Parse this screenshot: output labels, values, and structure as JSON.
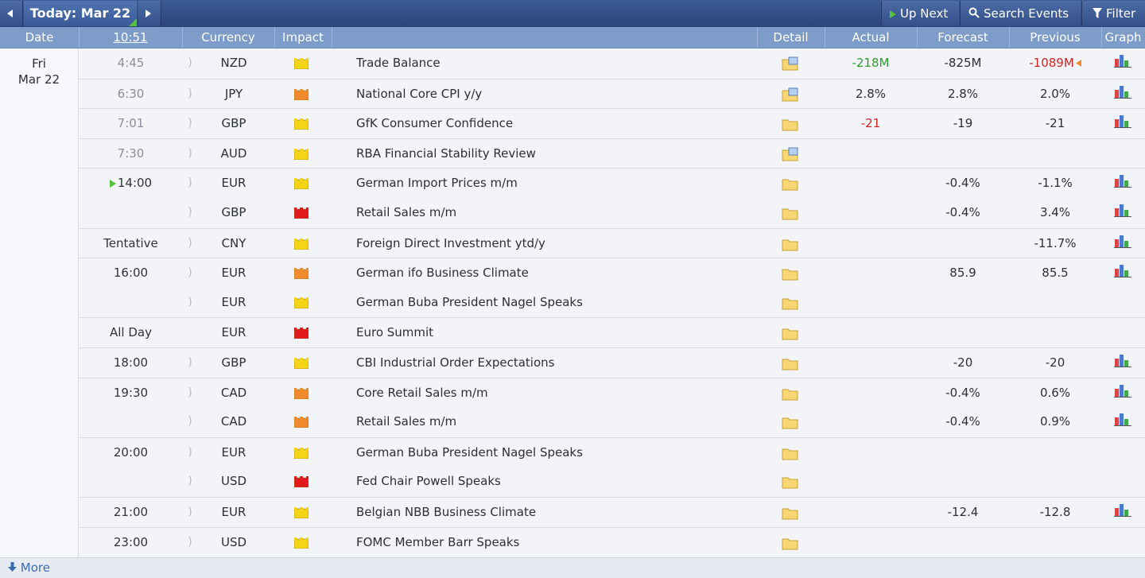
{
  "toolbar": {
    "today_label": "Today: Mar 22",
    "up_next_label": "Up Next",
    "search_label": "Search Events",
    "filter_label": "Filter"
  },
  "header": {
    "date": "Date",
    "time": "10:51",
    "currency": "Currency",
    "impact": "Impact",
    "detail": "Detail",
    "actual": "Actual",
    "forecast": "Forecast",
    "previous": "Previous",
    "graph": "Graph"
  },
  "date_cell": {
    "day": "Fri",
    "date": "Mar 22"
  },
  "colors": {
    "impact_high": "#e01a1a",
    "impact_medium": "#f08a2c",
    "impact_low": "#f5d417",
    "actual_better": "#2d9c2d",
    "actual_worse": "#d32424"
  },
  "events": [
    {
      "time": "4:45",
      "currency": "NZD",
      "impact": "low",
      "title": "Trade Balance",
      "actual": "-218M",
      "actual_color": "green",
      "forecast": "-825M",
      "previous": "-1089M",
      "previous_color": "red",
      "previous_revised": true,
      "graph": true,
      "detail": "detail-blue"
    },
    {
      "time": "6:30",
      "currency": "JPY",
      "impact": "medium",
      "title": "National Core CPI y/y",
      "actual": "2.8%",
      "actual_color": "",
      "forecast": "2.8%",
      "previous": "2.0%",
      "previous_color": "",
      "graph": true,
      "detail": "detail-blue"
    },
    {
      "time": "7:01",
      "currency": "GBP",
      "impact": "low",
      "title": "GfK Consumer Confidence",
      "actual": "-21",
      "actual_color": "red",
      "forecast": "-19",
      "previous": "-21",
      "previous_color": "",
      "graph": true,
      "detail": "folder"
    },
    {
      "time": "7:30",
      "currency": "AUD",
      "impact": "low",
      "title": "RBA Financial Stability Review",
      "actual": "",
      "actual_color": "",
      "forecast": "",
      "previous": "",
      "previous_color": "",
      "graph": false,
      "detail": "detail-blue"
    },
    {
      "time": "14:00",
      "currency": "EUR",
      "impact": "low",
      "title": "German Import Prices m/m",
      "actual": "",
      "actual_color": "",
      "forecast": "-0.4%",
      "previous": "-1.1%",
      "previous_color": "",
      "graph": true,
      "detail": "folder",
      "next_marker": true
    },
    {
      "time": "",
      "currency": "GBP",
      "impact": "high",
      "title": "Retail Sales m/m",
      "actual": "",
      "actual_color": "",
      "forecast": "-0.4%",
      "previous": "3.4%",
      "previous_color": "",
      "graph": true,
      "detail": "folder"
    },
    {
      "time": "Tentative",
      "currency": "CNY",
      "impact": "low",
      "title": "Foreign Direct Investment ytd/y",
      "actual": "",
      "actual_color": "",
      "forecast": "",
      "previous": "-11.7%",
      "previous_color": "",
      "graph": true,
      "detail": "folder"
    },
    {
      "time": "16:00",
      "currency": "EUR",
      "impact": "medium",
      "title": "German ifo Business Climate",
      "actual": "",
      "actual_color": "",
      "forecast": "85.9",
      "previous": "85.5",
      "previous_color": "",
      "graph": true,
      "detail": "folder"
    },
    {
      "time": "",
      "currency": "EUR",
      "impact": "low",
      "title": "German Buba President Nagel Speaks",
      "actual": "",
      "actual_color": "",
      "forecast": "",
      "previous": "",
      "previous_color": "",
      "graph": false,
      "detail": "folder"
    },
    {
      "time": "All Day",
      "currency": "EUR",
      "impact": "high",
      "title": "Euro Summit",
      "actual": "",
      "actual_color": "",
      "forecast": "",
      "previous": "",
      "previous_color": "",
      "graph": false,
      "detail": "folder",
      "no_sound": true
    },
    {
      "time": "18:00",
      "currency": "GBP",
      "impact": "low",
      "title": "CBI Industrial Order Expectations",
      "actual": "",
      "actual_color": "",
      "forecast": "-20",
      "previous": "-20",
      "previous_color": "",
      "graph": true,
      "detail": "folder"
    },
    {
      "time": "19:30",
      "currency": "CAD",
      "impact": "medium",
      "title": "Core Retail Sales m/m",
      "actual": "",
      "actual_color": "",
      "forecast": "-0.4%",
      "previous": "0.6%",
      "previous_color": "",
      "graph": true,
      "detail": "folder"
    },
    {
      "time": "",
      "currency": "CAD",
      "impact": "medium",
      "title": "Retail Sales m/m",
      "actual": "",
      "actual_color": "",
      "forecast": "-0.4%",
      "previous": "0.9%",
      "previous_color": "",
      "graph": true,
      "detail": "folder"
    },
    {
      "time": "20:00",
      "currency": "EUR",
      "impact": "low",
      "title": "German Buba President Nagel Speaks",
      "actual": "",
      "actual_color": "",
      "forecast": "",
      "previous": "",
      "previous_color": "",
      "graph": false,
      "detail": "folder"
    },
    {
      "time": "",
      "currency": "USD",
      "impact": "high",
      "title": "Fed Chair Powell Speaks",
      "actual": "",
      "actual_color": "",
      "forecast": "",
      "previous": "",
      "previous_color": "",
      "graph": false,
      "detail": "folder"
    },
    {
      "time": "21:00",
      "currency": "EUR",
      "impact": "low",
      "title": "Belgian NBB Business Climate",
      "actual": "",
      "actual_color": "",
      "forecast": "-12.4",
      "previous": "-12.8",
      "previous_color": "",
      "graph": true,
      "detail": "folder"
    },
    {
      "time": "23:00",
      "currency": "USD",
      "impact": "low",
      "title": "FOMC Member Barr Speaks",
      "actual": "",
      "actual_color": "",
      "forecast": "",
      "previous": "",
      "previous_color": "",
      "graph": false,
      "detail": "folder"
    }
  ],
  "footer": {
    "more_label": "More"
  }
}
